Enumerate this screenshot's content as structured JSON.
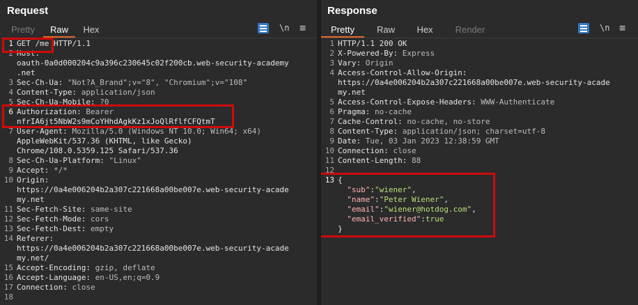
{
  "request": {
    "title": "Request",
    "tabs": [
      "Pretty",
      "Raw",
      "Hex"
    ],
    "active_tab": "Raw",
    "toolbar": {
      "newline_toggle": "\\n"
    },
    "lines": [
      {
        "n": "1",
        "text": "GET /me HTTP/1.1"
      },
      {
        "n": "2",
        "key": "Host:",
        "val": ""
      },
      {
        "n": "",
        "text": "oauth-0a0d000204c9a396c230645c02f200cb.web-security-academy"
      },
      {
        "n": "",
        "text": ".net"
      },
      {
        "n": "3",
        "key": "Sec-Ch-Ua:",
        "val": " \"Not?A_Brand\";v=\"8\", \"Chromium\";v=\"108\""
      },
      {
        "n": "4",
        "key": "Content-Type:",
        "val": " application/json"
      },
      {
        "n": "5",
        "key": "Sec-Ch-Ua-Mobile:",
        "val": " ?0"
      },
      {
        "n": "6",
        "key": "Authorization:",
        "val": " Bearer"
      },
      {
        "n": "",
        "text": "nfrIA6jt5NbW2s9mCoYHhdAgkKz1xJoQlRflfCFQtmT"
      },
      {
        "n": "7",
        "key": "User-Agent:",
        "val": " Mozilla/5.0 (Windows NT 10.0; Win64; x64)"
      },
      {
        "n": "",
        "text": "AppleWebKit/537.36 (KHTML, like Gecko)"
      },
      {
        "n": "",
        "text": "Chrome/108.0.5359.125 Safari/537.36"
      },
      {
        "n": "8",
        "key": "Sec-Ch-Ua-Platform:",
        "val": " \"Linux\""
      },
      {
        "n": "9",
        "key": "Accept:",
        "val": " */*"
      },
      {
        "n": "10",
        "key": "Origin:",
        "val": ""
      },
      {
        "n": "",
        "text": "https://0a4e006204b2a307c221668a00be007e.web-security-acade"
      },
      {
        "n": "",
        "text": "my.net"
      },
      {
        "n": "11",
        "key": "Sec-Fetch-Site:",
        "val": " same-site"
      },
      {
        "n": "12",
        "key": "Sec-Fetch-Mode:",
        "val": " cors"
      },
      {
        "n": "13",
        "key": "Sec-Fetch-Dest:",
        "val": " empty"
      },
      {
        "n": "14",
        "key": "Referer:",
        "val": ""
      },
      {
        "n": "",
        "text": "https://0a4e006204b2a307c221668a00be007e.web-security-acade"
      },
      {
        "n": "",
        "text": "my.net/"
      },
      {
        "n": "15",
        "key": "Accept-Encoding:",
        "val": " gzip, deflate"
      },
      {
        "n": "16",
        "key": "Accept-Language:",
        "val": " en-US,en;q=0.9"
      },
      {
        "n": "17",
        "key": "Connection:",
        "val": " close"
      },
      {
        "n": "18",
        "text": ""
      }
    ]
  },
  "response": {
    "title": "Response",
    "tabs": [
      "Pretty",
      "Raw",
      "Hex",
      "Render"
    ],
    "active_tab": "Pretty",
    "toolbar": {
      "newline_toggle": "\\n"
    },
    "lines": [
      {
        "n": "1",
        "text": "HTTP/1.1 200 OK"
      },
      {
        "n": "2",
        "key": "X-Powered-By:",
        "val": " Express"
      },
      {
        "n": "3",
        "key": "Vary:",
        "val": " Origin"
      },
      {
        "n": "4",
        "key": "Access-Control-Allow-Origin:",
        "val": ""
      },
      {
        "n": "",
        "text": "https://0a4e006204b2a307c221668a00be007e.web-security-acade"
      },
      {
        "n": "",
        "text": "my.net"
      },
      {
        "n": "5",
        "key": "Access-Control-Expose-Headers:",
        "val": " WWW-Authenticate"
      },
      {
        "n": "6",
        "key": "Pragma:",
        "val": " no-cache"
      },
      {
        "n": "7",
        "key": "Cache-Control:",
        "val": " no-cache, no-store"
      },
      {
        "n": "8",
        "key": "Content-Type:",
        "val": " application/json; charset=utf-8"
      },
      {
        "n": "9",
        "key": "Date:",
        "val": " Tue, 03 Jan 2023 12:38:59 GMT"
      },
      {
        "n": "10",
        "key": "Connection:",
        "val": " close"
      },
      {
        "n": "11",
        "key": "Content-Length:",
        "val": " 88"
      },
      {
        "n": "12",
        "text": ""
      },
      {
        "n": "13",
        "text": "{"
      },
      {
        "n": "",
        "json": true,
        "jkey": "\"sub\"",
        "jval": "\"wiener\"",
        "tail": ","
      },
      {
        "n": "",
        "json": true,
        "jkey": "\"name\"",
        "jval": "\"Peter Wiener\"",
        "tail": ","
      },
      {
        "n": "",
        "json": true,
        "jkey": "\"email\"",
        "jval": "\"wiener@hotdog.com\"",
        "tail": ","
      },
      {
        "n": "",
        "json": true,
        "jkey": "\"email_verified\"",
        "jval": "true",
        "tail": ""
      },
      {
        "n": "",
        "text": "}"
      }
    ]
  },
  "colors": {
    "highlight": "#d10a0a",
    "accent_tab": "#e36b2f",
    "active_button": "#3577c2"
  }
}
